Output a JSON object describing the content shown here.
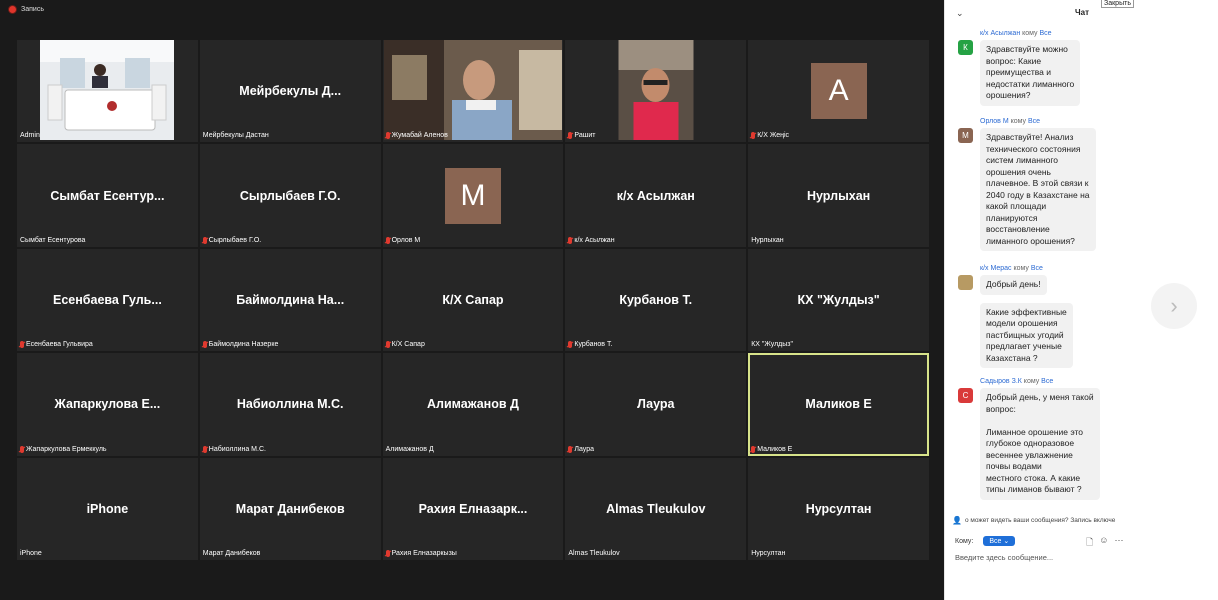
{
  "meeting": {
    "recording_label": "Запись",
    "active_index": 19,
    "tiles": [
      {
        "name": "",
        "label": "Admin",
        "muted": false,
        "kind": "video",
        "video": "office"
      },
      {
        "name": "Мейрбекулы Д...",
        "label": "Мейрбекулы Дастан",
        "muted": false,
        "kind": "text"
      },
      {
        "name": "",
        "label": "Жумабай Аленов",
        "muted": true,
        "kind": "video",
        "video": "man"
      },
      {
        "name": "",
        "label": "Рашит",
        "muted": true,
        "kind": "video",
        "video": "car"
      },
      {
        "name": "",
        "label": "К/Х Жеңіс",
        "muted": true,
        "kind": "avatar",
        "letter": "A"
      },
      {
        "name": "Сымбат Есентур...",
        "label": "Сымбат Есентурова",
        "muted": false,
        "kind": "text"
      },
      {
        "name": "Сырлыбаев Г.О.",
        "label": "Сырлыбаев Г.О.",
        "muted": true,
        "kind": "text"
      },
      {
        "name": "",
        "label": "Орлов М",
        "muted": true,
        "kind": "avatar",
        "letter": "M"
      },
      {
        "name": "к/х Асылжан",
        "label": "к/х Асылжан",
        "muted": true,
        "kind": "text"
      },
      {
        "name": "Нурлыхан",
        "label": "Нурлыхан",
        "muted": false,
        "kind": "text"
      },
      {
        "name": "Есенбаева Гуль...",
        "label": "Есенбаева Гульвира",
        "muted": true,
        "kind": "text"
      },
      {
        "name": "Баймолдина На...",
        "label": "Баймолдина Назерке",
        "muted": true,
        "kind": "text"
      },
      {
        "name": "К/Х Сапар",
        "label": "К/Х Сапар",
        "muted": true,
        "kind": "text"
      },
      {
        "name": "Курбанов Т.",
        "label": "Курбанов Т.",
        "muted": true,
        "kind": "text"
      },
      {
        "name": "КХ \"Жулдыз\"",
        "label": "КХ \"Жулдыз\"",
        "muted": false,
        "kind": "text"
      },
      {
        "name": "Жапаркулова Е...",
        "label": "Жапаркулова Ермеккуль",
        "muted": true,
        "kind": "text"
      },
      {
        "name": "Набиоллина М.С.",
        "label": "Набиоллина М.С.",
        "muted": true,
        "kind": "text"
      },
      {
        "name": "Алимажанов Д",
        "label": "Алимажанов Д",
        "muted": false,
        "kind": "text"
      },
      {
        "name": "Лаура",
        "label": "Лаура",
        "muted": true,
        "kind": "text"
      },
      {
        "name": "Маликов Е",
        "label": "Маликов Е",
        "muted": true,
        "kind": "text"
      },
      {
        "name": "iPhone",
        "label": "iPhone",
        "muted": false,
        "kind": "text"
      },
      {
        "name": "Марат Данибеков",
        "label": "Марат Данибеков",
        "muted": false,
        "kind": "text"
      },
      {
        "name": "Рахия Елназарк...",
        "label": "Рахия Елназаркызы",
        "muted": true,
        "kind": "text"
      },
      {
        "name": "Almas Tleukulov",
        "label": "Almas Tleukulov",
        "muted": false,
        "kind": "text"
      },
      {
        "name": "Нурсултан",
        "label": "Нурсултан",
        "muted": false,
        "kind": "text"
      }
    ],
    "colors": {
      "avatar_bg": "#8a6552",
      "active_border": "#d7e38a"
    }
  },
  "chat": {
    "title": "Чат",
    "close_tooltip": "Закрыть",
    "to_word": "кому",
    "messages": [
      {
        "sender": "к/х Асылжан",
        "to": "Все",
        "avatar_letter": "К",
        "avatar_color": "#25a244",
        "bubbles": [
          "Здравствуйте можно\nвопрос: Какие\nпреимущества и\nнедостатки лиманного\nорошения?"
        ]
      },
      {
        "sender": "Орлов М",
        "to": "Все",
        "avatar_letter": "M",
        "avatar_color": "#8a6552",
        "bubbles": [
          "Здравствуйте! Анализ\nтехнического состояния\nсистем лиманного\nорошения очень\nплачевное. В этой связи к\n2040 году в Казахстане на\nкакой площади\nпланируются\nвосстановление\nлиманного орошения?"
        ]
      },
      {
        "sender": "к/х Мерас",
        "to": "Все",
        "avatar_letter": "",
        "avatar_color": "#b79a63",
        "bubbles": [
          "Добрый день!",
          "Какие эффективные\nмодели орошения\nпастбищных угодий\nпредлагает ученые\nКазахстана ?"
        ]
      },
      {
        "sender": "Садыров З.К",
        "to": "Все",
        "avatar_letter": "C",
        "avatar_color": "#d93a3a",
        "bubbles": [
          "Добрый день, у меня такой\nвопрос:\n\nЛиманное орошение это\nглубокое одноразовое\nвесеннее увлажнение\nпочвы        водами\nместного стока. А какие\nтипы лиманов бывают ?"
        ]
      }
    ],
    "notice": "о может видеть ваши сообщения? Запись включе",
    "to_label": "Кому:",
    "to_value": "Все",
    "input_placeholder": "Введите здесь сообщение..."
  }
}
